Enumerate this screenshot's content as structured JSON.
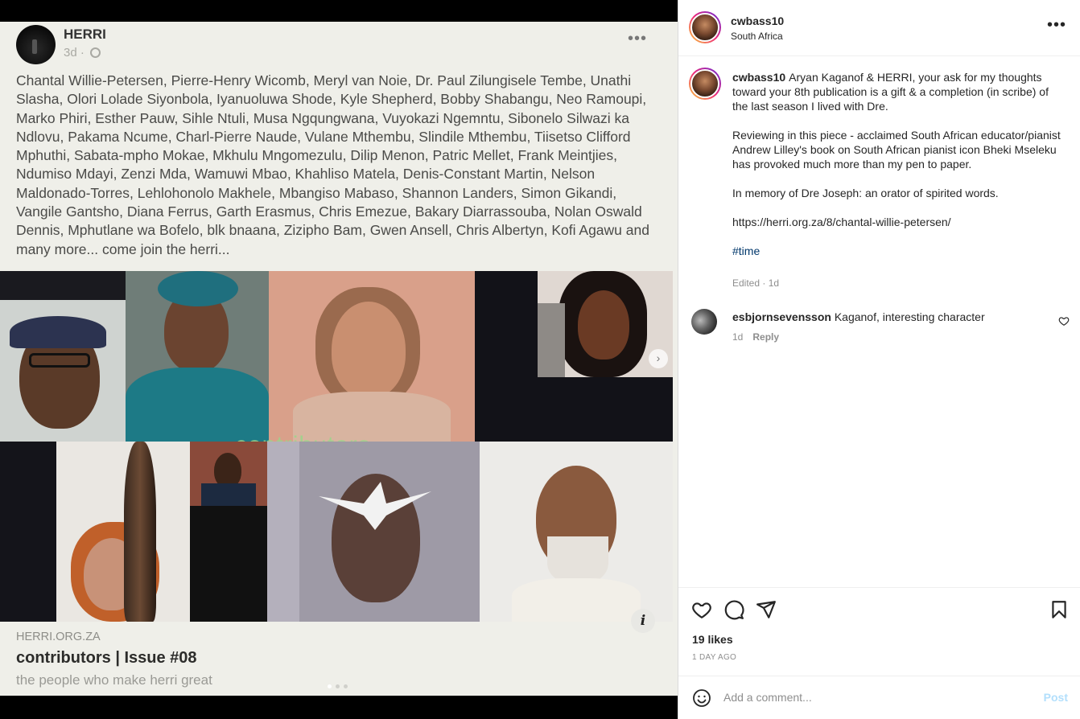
{
  "media": {
    "author": "HERRI",
    "time": "3d ·",
    "names": "Chantal Willie-Petersen, Pierre-Henry Wicomb, Meryl van Noie, Dr. Paul Zilungisele Tembe, Unathi Slasha, Olori Lolade Siyonbola, Iyanuoluwa Shode, Kyle Shepherd, Bobby Shabangu, Neo Ramoupi, Marko Phiri, Esther Pauw, Sihle Ntuli, Musa Ngqungwana, Vuyokazi Ngemntu, Sibonelo Silwazi ka Ndlovu, Pakama Ncume, Charl-Pierre Naude, Vulane Mthembu, Slindile Mthembu, Tiisetso Clifford Mphuthi, Sabata-mpho Mokae, Mkhulu Mngomezulu, Dilip Menon, Patric Mellet, Frank Meintjies, Ndumiso Mdayi, Zenzi Mda, Wamuwi Mbao, Khahliso Matela, Denis-Constant Martin, Nelson Maldonado-Torres, Lehlohonolo Makhele, Mbangiso Mabaso, Shannon Landers, Simon Gikandi, Vangile Gantsho, Diana Ferrus, Garth Erasmus, Chris Emezue, Bakary Diarrassouba, Nolan Oswald Dennis, Mphutlane wa Bofelo, blk bnaana, Zizipho Bam, Gwen Ansell, Chris Albertyn, Kofi Agawu and many more... come join the herri...",
    "collage_word": "contributors",
    "link_domain": "HERRI.ORG.ZA",
    "link_title": "contributors | Issue #08",
    "link_subtitle": "the people who make herri great"
  },
  "post": {
    "username": "cwbass10",
    "location": "South Africa",
    "caption_p1": "Aryan Kaganof & HERRI, your ask for my thoughts toward your 8th publication is a gift & a completion (in scribe) of the last season I lived with Dre.",
    "caption_p2": "Reviewing in this piece - acclaimed South African educator/pianist Andrew Lilley's book on South African pianist icon Bheki Mseleku has provoked much more than my pen to paper.",
    "caption_p3": "In memory of Dre Joseph: an orator of spirited words.",
    "caption_link": "https://herri.org.za/8/chantal-willie-petersen/",
    "hashtag": "#time",
    "edited": "Edited · 1d",
    "likes": "19 likes",
    "ago": "1 DAY AGO"
  },
  "comment": {
    "username": "esbjornsevensson",
    "text": "Kaganof, interesting character",
    "time": "1d",
    "reply": "Reply"
  },
  "composer": {
    "placeholder": "Add a comment...",
    "post_label": "Post"
  },
  "colors": {
    "accent_link": "#00376b",
    "post_button": "#b2dffc"
  }
}
